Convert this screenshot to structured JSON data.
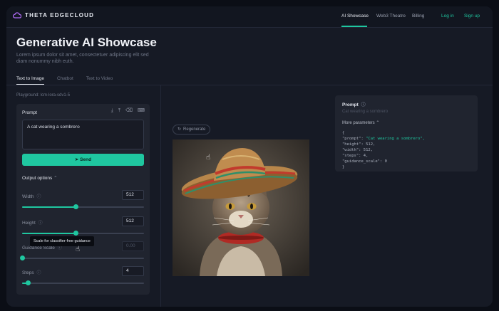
{
  "app": {
    "brand": "THETA EDGECLOUD",
    "accent": "#1fc7a0"
  },
  "nav": {
    "links": [
      "AI Showcase",
      "Web3 Theatre",
      "Billing"
    ],
    "login": "Log in",
    "signup": "Sign up"
  },
  "header": {
    "title": "Generative AI Showcase",
    "subtitle": "Lorem ipsum dolor sit amet, consectetuer adipiscing elit sed diam nonummy nibh euth."
  },
  "tabs": [
    "Text to Image",
    "Chatbot",
    "Text to Video"
  ],
  "playground": "Playground: lcm-lora-sdv1-5",
  "prompt_panel": {
    "label": "Prompt",
    "value": "A cat wearing a sombrero",
    "send_label": "Send",
    "icons": [
      "download-icon",
      "upload-icon",
      "eraser-icon",
      "keyboard-icon"
    ]
  },
  "output_options": {
    "label": "Output options",
    "width": {
      "label": "Width",
      "value": "512",
      "level": 0.44
    },
    "height": {
      "label": "Height",
      "value": "512",
      "level": 0.44
    },
    "guidance": {
      "label": "Guidance Scale",
      "value": "0.00",
      "level": 0.0
    },
    "steps": {
      "label": "Steps",
      "value": "4",
      "level": 0.05
    },
    "tooltip": "Scale for classifier-free guidance"
  },
  "result": {
    "regenerate_label": "Regenerate",
    "image_description": "cat-wearing-sombrero"
  },
  "params": {
    "prompt_label": "Prompt",
    "prompt_value": "Cat wearing a sombrero",
    "more_label": "More parameters",
    "json_open": "{",
    "json_prompt_key": "\"prompt\": ",
    "json_prompt_val": "\"Cat wearing a sombrero\",",
    "json_height": "\"height\": 512,",
    "json_width": "\"width\": 512,",
    "json_steps": "\"steps\": 4,",
    "json_guidance": "\"guidance_scale\": 0",
    "json_close": "}"
  }
}
